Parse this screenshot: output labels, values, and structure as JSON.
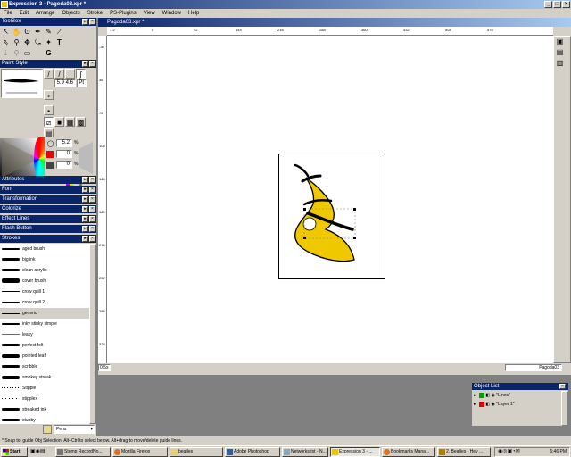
{
  "app": {
    "title": "Expression 3 - Pagoda03.xpr *"
  },
  "menu": [
    "File",
    "Edit",
    "Arrange",
    "Objects",
    "Stroke",
    "PS-Plugins",
    "View",
    "Window",
    "Help"
  ],
  "toolbox": {
    "title": "ToolBox"
  },
  "paint_style": {
    "title": "Paint Style",
    "width_value": "5.9",
    "width_value2": "4.6",
    "unit": "Pt",
    "color_value1": "5.2",
    "color_value2": "0",
    "color_value3": "0",
    "pct": "%"
  },
  "panels": [
    "Attributes",
    "Font",
    "Transformation",
    "Colorize",
    "Effect Lines",
    "Flash Button",
    "Strokes"
  ],
  "strokes": [
    {
      "name": "aged brush"
    },
    {
      "name": "big ink"
    },
    {
      "name": "clean acrylic"
    },
    {
      "name": "cover brush"
    },
    {
      "name": "crow quill 1"
    },
    {
      "name": "crow quill 2"
    },
    {
      "name": "generic"
    },
    {
      "name": "inky stinky simple"
    },
    {
      "name": "leaky"
    },
    {
      "name": "perfect felt"
    },
    {
      "name": "pointed leaf"
    },
    {
      "name": "scribble"
    },
    {
      "name": "smokey streak"
    },
    {
      "name": "Stipple"
    },
    {
      "name": "stipplex"
    },
    {
      "name": "streaked ink"
    },
    {
      "name": "stubby"
    }
  ],
  "strokes_category": "Pens",
  "document": {
    "title": "Pagoda03.xpr *",
    "zoom": "0.5x",
    "page_label": "Pagoda03"
  },
  "ruler_labels": {
    "top": [
      "-72",
      "0",
      "72",
      "144",
      "216",
      "288",
      "360",
      "432",
      "504",
      "576"
    ],
    "left": [
      "-36",
      "36",
      "72",
      "108",
      "144",
      "180",
      "216",
      "252",
      "288",
      "324"
    ]
  },
  "object_list": {
    "title": "Object List",
    "layers": [
      {
        "name": "\"Lines\"",
        "color": "#00a000"
      },
      {
        "name": "\"Layer 1\"",
        "color": "#e00000"
      }
    ]
  },
  "status": "* Snap to: guide    Obj Selection: Alt+Ctrl to select below. Alt+drag to move/delete guide lines.",
  "taskbar": {
    "start": "Start",
    "tasks": [
      "Stomp RecordNo...",
      "Mozilla Firefox",
      "beatles",
      "Adobe Photoshop",
      "Networks.txt - N...",
      "Expression 3 - ...",
      "Bookmarks Mana...",
      "2. Beatles - Hey ..."
    ],
    "clock": "6:46 PM"
  },
  "colors": {
    "selection": "#0a246a",
    "shape_fill": "#f0c800",
    "taskbar": "#d4d0c8"
  }
}
